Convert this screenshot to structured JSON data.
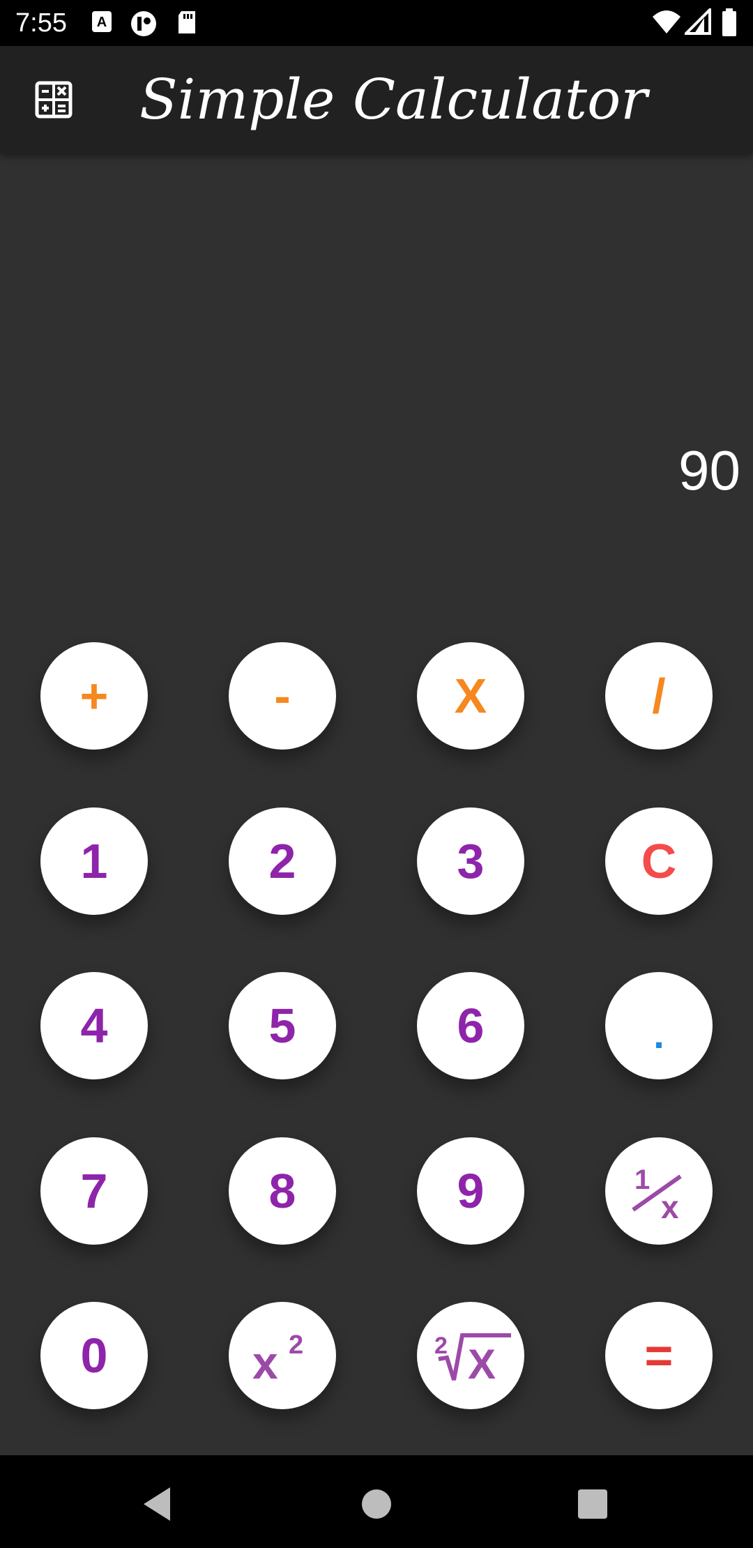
{
  "status_bar": {
    "time": "7:55",
    "left_icons": [
      "font-a-icon",
      "notification-app-icon",
      "sd-card-icon"
    ],
    "right_icons": [
      "wifi-icon",
      "signal-icon",
      "battery-icon"
    ]
  },
  "app_bar": {
    "icon": "calculator-icon",
    "title": "Simple Calculator"
  },
  "display": {
    "value": "90"
  },
  "keypad": {
    "plus": "+",
    "minus": "-",
    "multiply": "X",
    "divide": "/",
    "one": "1",
    "two": "2",
    "three": "3",
    "clear": "C",
    "four": "4",
    "five": "5",
    "six": "6",
    "decimal": ".",
    "seven": "7",
    "eight": "8",
    "nine": "9",
    "reciprocal": "1/x",
    "zero": "0",
    "square": "x²",
    "square_root": "²√x",
    "equals": "="
  },
  "colors": {
    "operator": "#f5881f",
    "digit": "#8e24aa",
    "clear": "#f44b4b",
    "decimal": "#1e88e5",
    "function": "#9c4aa8",
    "equals": "#e53935",
    "background": "#303030",
    "app_bar": "#212121"
  },
  "nav_bar": {
    "icons": [
      "back-icon",
      "home-icon",
      "recents-icon"
    ]
  }
}
